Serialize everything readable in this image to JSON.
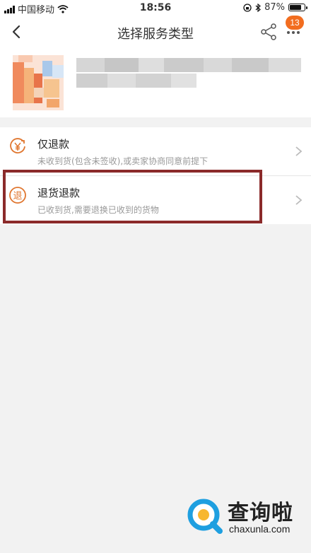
{
  "status_bar": {
    "carrier": "中国移动",
    "time": "18:56",
    "battery": "87%",
    "battery_level": 0.87
  },
  "nav": {
    "title": "选择服务类型",
    "badge_count": "13",
    "icons": [
      "back-icon",
      "share-icon",
      "more-icon"
    ]
  },
  "options": [
    {
      "title": "仅退款",
      "description": "未收到货(包含未签收),或卖家协商同意前提下",
      "icon": "yuan-circle-arrow-icon"
    },
    {
      "title": "退货退款",
      "description": "已收到货,需要退换已收到的货物",
      "icon": "return-circle-icon",
      "icon_char": "退"
    }
  ],
  "watermark": {
    "cn": "查询啦",
    "en": "chaxunla.com"
  },
  "colors": {
    "accent": "#f26d1f",
    "highlight": "#8b2a2a",
    "background": "#f2f2f2"
  }
}
